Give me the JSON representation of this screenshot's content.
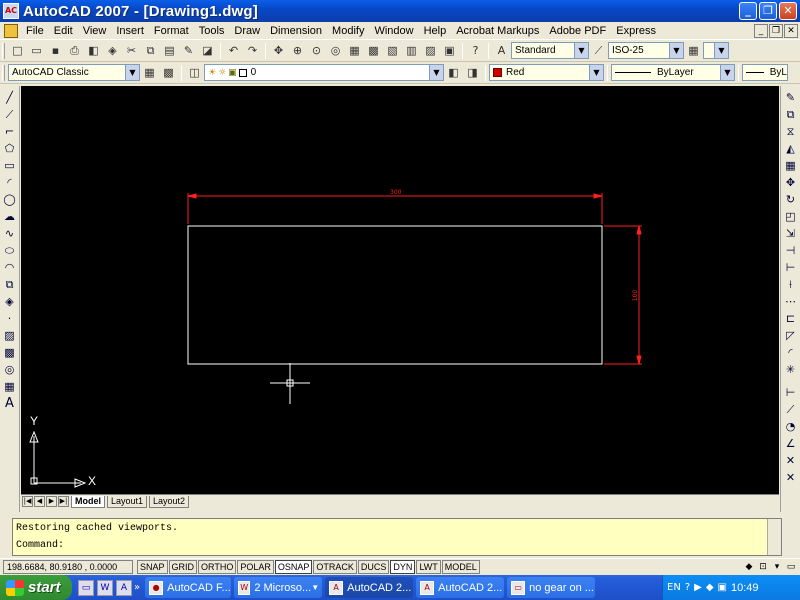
{
  "window": {
    "title": "AutoCAD 2007 - [Drawing1.dwg]",
    "icon": "autocad-logo-icon",
    "minimize": "_",
    "maximize": "❐",
    "close": "✕"
  },
  "menu": {
    "items": [
      "File",
      "Edit",
      "View",
      "Insert",
      "Format",
      "Tools",
      "Draw",
      "Dimension",
      "Modify",
      "Window",
      "Help",
      "Acrobat Markups",
      "Adobe PDF",
      "Express"
    ]
  },
  "toolbar1": {
    "text_style": "Standard",
    "dim_style": "ISO-25"
  },
  "toolbar2": {
    "workspace": "AutoCAD Classic",
    "layer": "0",
    "color": "Red",
    "linetype": "ByLayer",
    "lineweight": "ByL"
  },
  "drawing": {
    "dim_horizontal": "300",
    "dim_vertical": "100",
    "ucs_x": "X",
    "ucs_y": "Y"
  },
  "layout_tabs": [
    "Model",
    "Layout1",
    "Layout2"
  ],
  "command": {
    "history": "Restoring cached viewports.",
    "prompt": "Command:"
  },
  "status": {
    "coordinates": "198.6684, 80.9180 , 0.0000",
    "toggles": [
      "SNAP",
      "GRID",
      "ORTHO",
      "POLAR",
      "OSNAP",
      "OTRACK",
      "DUCS",
      "DYN",
      "LWT",
      "MODEL"
    ]
  },
  "taskbar": {
    "start_label": "start",
    "tasks": [
      "AutoCAD F...",
      "2 Microso...",
      "AutoCAD 2...",
      "AutoCAD 2...",
      "no gear on ..."
    ],
    "language": "EN",
    "clock": "10:49"
  },
  "colors": {
    "canvas_bg": "#000000",
    "dimension": "#ff2020",
    "geometry": "#ffffff"
  }
}
